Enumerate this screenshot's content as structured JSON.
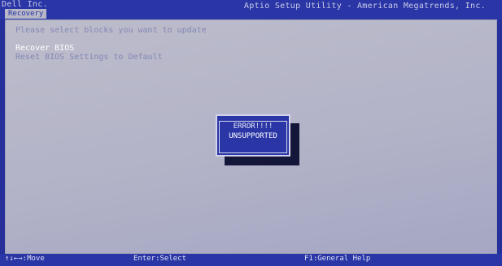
{
  "header": {
    "vendor": "Dell Inc.",
    "title": "Aptio Setup Utility - American Megatrends, Inc.",
    "tab": "Recovery"
  },
  "main": {
    "instruction": "Please select blocks you want to update",
    "options": [
      {
        "label": "Recover BIOS",
        "selected": true
      },
      {
        "label": "Reset BIOS Settings to Default",
        "selected": false
      }
    ]
  },
  "dialog": {
    "title": "ERROR!!!!",
    "message": "UNSUPPORTED"
  },
  "footer": {
    "hints": [
      "↑↓←→:Move",
      "Enter:Select",
      "F1:General Help"
    ]
  },
  "colors": {
    "bios_blue": "#2a36a6",
    "panel_gray": "#b7b7c7",
    "text_dim": "#8587b5",
    "text_highlight": "#ffffff"
  }
}
